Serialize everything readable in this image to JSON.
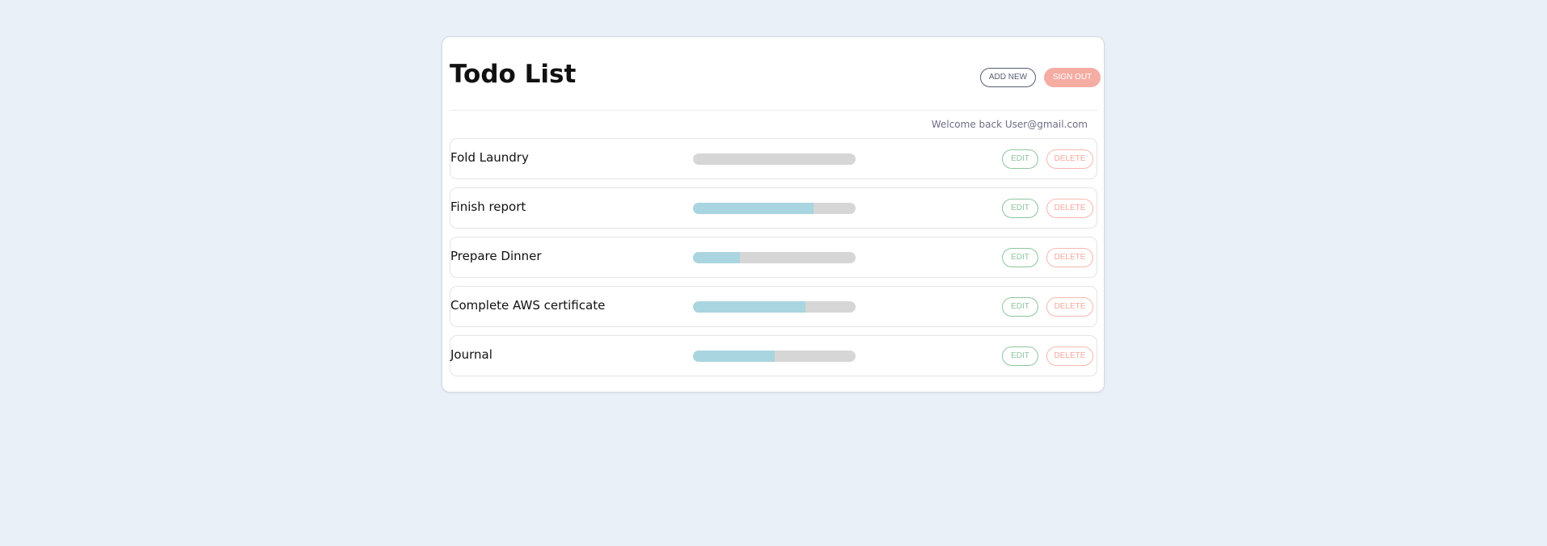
{
  "app": {
    "title": "Todo List",
    "add_new_label": "ADD NEW",
    "sign_out_label": "SIGN OUT",
    "welcome_text": "Welcome back User@gmail.com"
  },
  "todos": [
    {
      "name": "Fold Laundry",
      "progress": 0,
      "edit_label": "EDIT",
      "delete_label": "DELETE"
    },
    {
      "name": "Finish report",
      "progress": 0.74,
      "edit_label": "EDIT",
      "delete_label": "DELETE"
    },
    {
      "name": "Prepare Dinner",
      "progress": 0.29,
      "edit_label": "EDIT",
      "delete_label": "DELETE"
    },
    {
      "name": "Complete AWS certificate",
      "progress": 0.69,
      "edit_label": "EDIT",
      "delete_label": "DELETE"
    },
    {
      "name": "Journal",
      "progress": 0.5,
      "edit_label": "EDIT",
      "delete_label": "DELETE"
    }
  ],
  "colors": {
    "page_background": "#e9f0f8",
    "progress_fill": "#a9d5e0",
    "progress_track": "#d6d6d6",
    "edit_accent": "#8ec59e",
    "delete_accent": "#f6a89e",
    "sign_out_background": "#f5aca3"
  }
}
